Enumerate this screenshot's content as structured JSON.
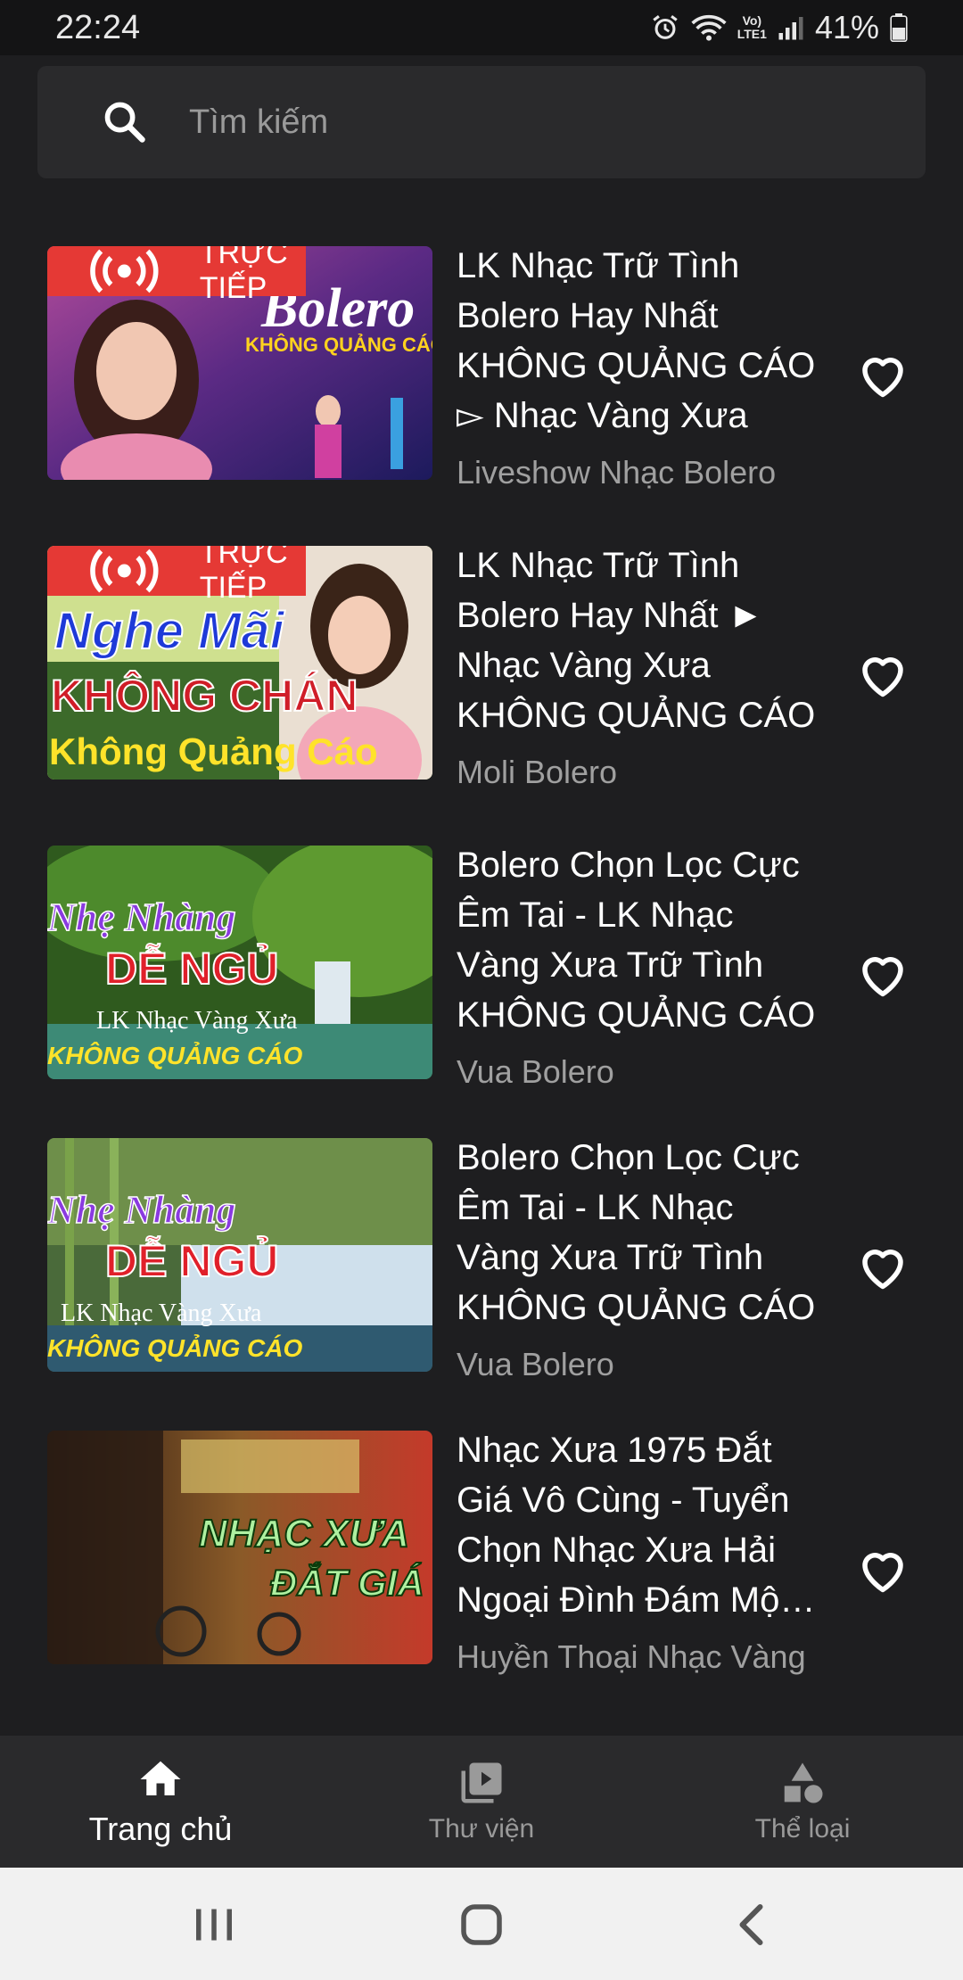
{
  "status_bar": {
    "time": "22:24",
    "volte_line1": "Vo)",
    "volte_line2": "LTE1",
    "battery": "41%"
  },
  "search": {
    "placeholder": "Tìm kiếm"
  },
  "live_badge_label": "TRỰC TIẾP",
  "items": [
    {
      "title": "LK Nhạc Trữ Tình Bolero Hay Nhất KHÔNG QUẢNG CÁO ▻ Nhạc Vàng Xưa",
      "channel": "Liveshow Nhạc Bolero",
      "live": true,
      "thumb_text": [
        "Bolero",
        "KHÔNG QUẢNG CÁO"
      ]
    },
    {
      "title": "LK Nhạc Trữ Tình Bolero Hay Nhất ► Nhạc Vàng Xưa KHÔNG QUẢNG CÁO",
      "channel": "Moli Bolero",
      "live": true,
      "thumb_text": [
        "Nghe Mãi",
        "KHÔNG CHÁN",
        "Không Quảng Cáo"
      ]
    },
    {
      "title": "Bolero Chọn Lọc Cực Êm Tai - LK Nhạc Vàng Xưa Trữ Tình KHÔNG QUẢNG CÁO",
      "channel": "Vua Bolero",
      "live": false,
      "thumb_text": [
        "Nhẹ Nhàng",
        "DỄ NGỦ",
        "LK Nhạc Vàng Xưa",
        "KHÔNG QUẢNG CÁO"
      ]
    },
    {
      "title": "Bolero Chọn Lọc Cực Êm Tai - LK Nhạc Vàng Xưa Trữ Tình KHÔNG QUẢNG CÁO",
      "channel": "Vua Bolero",
      "live": false,
      "thumb_text": [
        "Nhẹ Nhàng",
        "DỄ NGỦ",
        "LK Nhạc Vàng Xưa",
        "KHÔNG QUẢNG CÁO"
      ]
    },
    {
      "title": "Nhạc Xưa 1975 Đắt Giá Vô Cùng - Tuyển Chọn Nhạc Xưa Hải Ngoại Đình Đám Một Thời",
      "channel": "Huyền Thoại Nhạc Vàng",
      "live": false,
      "thumb_text": [
        "NHẠC XƯA",
        "ĐẮT GIÁ"
      ]
    }
  ],
  "nav": {
    "home": "Trang chủ",
    "library": "Thư viện",
    "categories": "Thể loại"
  },
  "colors": {
    "background": "#1e1e20",
    "bar": "#2a2a2c",
    "live": "#e53935",
    "subtext": "#a0a0a0"
  }
}
